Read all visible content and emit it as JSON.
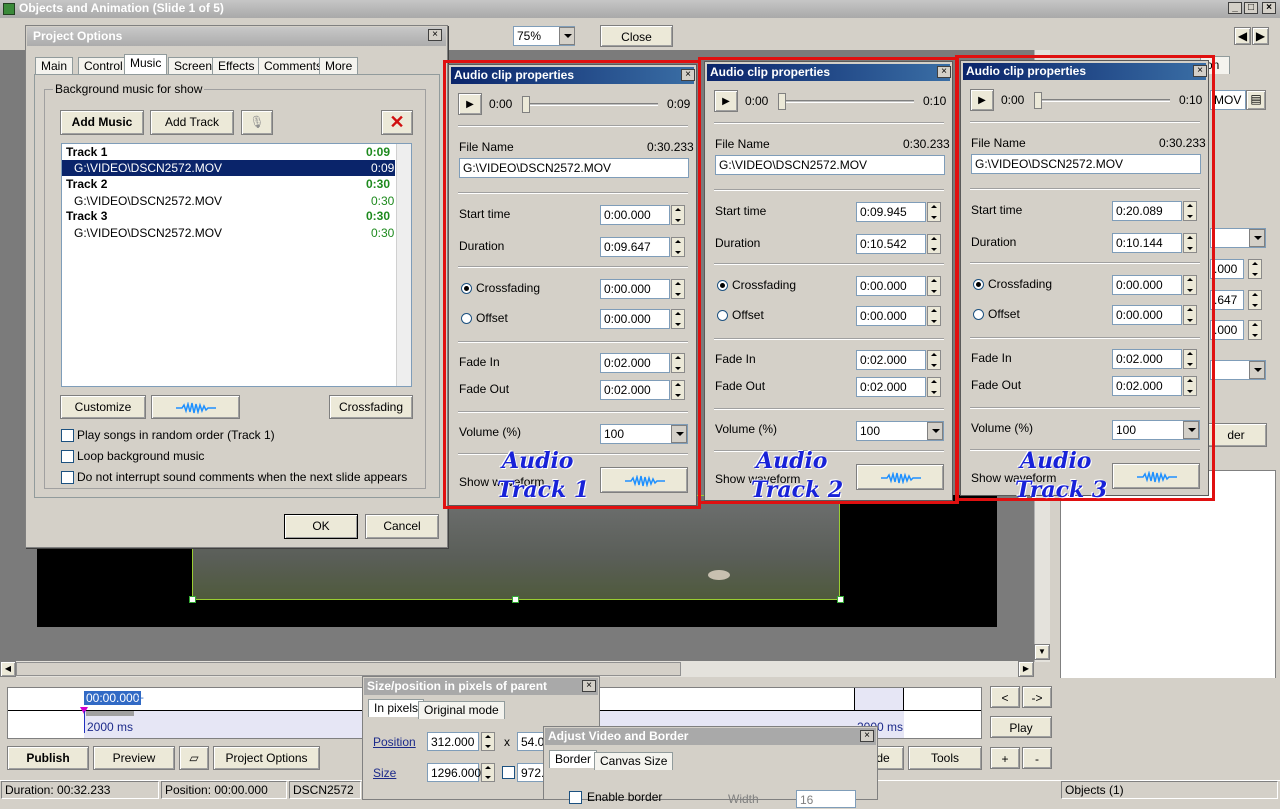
{
  "window": {
    "title": "Objects and Animation  (Slide 1 of 5)",
    "zoom": "75%",
    "close_label": "Close"
  },
  "project_options": {
    "title": "Project Options",
    "tabs": [
      "Main",
      "Control",
      "Music",
      "Screen",
      "Effects",
      "Comments",
      "More"
    ],
    "active_tab": "Music",
    "group_label": "Background music for show",
    "add_music": "Add Music",
    "add_track": "Add Track",
    "tracks": [
      {
        "name": "Track 1",
        "duration": "0:09",
        "file": "G:\\VIDEO\\DSCN2572.MOV",
        "file_duration": "0:09",
        "selected": true
      },
      {
        "name": "Track 2",
        "duration": "0:30",
        "file": "G:\\VIDEO\\DSCN2572.MOV",
        "file_duration": "0:30",
        "selected": false
      },
      {
        "name": "Track 3",
        "duration": "0:30",
        "file": "G:\\VIDEO\\DSCN2572.MOV",
        "file_duration": "0:30",
        "selected": false
      }
    ],
    "customize": "Customize",
    "crossfading": "Crossfading",
    "opt_random": "Play songs in random order (Track 1)",
    "opt_loop": "Loop background music",
    "opt_nointerrupt": "Do not interrupt sound comments when the next slide appears",
    "ok": "OK",
    "cancel": "Cancel"
  },
  "audio_dialogs": [
    {
      "title": "Audio clip properties",
      "pos_start": "0:00",
      "pos_end": "0:09",
      "file_name_label": "File Name",
      "file_length": "0:30.233",
      "file_path": "G:\\VIDEO\\DSCN2572.MOV",
      "start_time_label": "Start time",
      "start_time": "0:00.000",
      "duration_label": "Duration",
      "duration": "0:09.647",
      "crossfading_label": "Crossfading",
      "crossfading": "0:00.000",
      "offset_label": "Offset",
      "offset": "0:00.000",
      "fade_in_label": "Fade In",
      "fade_in": "0:02.000",
      "fade_out_label": "Fade Out",
      "fade_out": "0:02.000",
      "volume_label": "Volume (%)",
      "volume": "100",
      "waveform_label": "Show waveform",
      "annotation_line1": "Audio",
      "annotation_line2": "Track 1"
    },
    {
      "title": "Audio clip properties",
      "pos_start": "0:00",
      "pos_end": "0:10",
      "file_name_label": "File Name",
      "file_length": "0:30.233",
      "file_path": "G:\\VIDEO\\DSCN2572.MOV",
      "start_time_label": "Start time",
      "start_time": "0:09.945",
      "duration_label": "Duration",
      "duration": "0:10.542",
      "crossfading_label": "Crossfading",
      "crossfading": "0:00.000",
      "offset_label": "Offset",
      "offset": "0:00.000",
      "fade_in_label": "Fade In",
      "fade_in": "0:02.000",
      "fade_out_label": "Fade Out",
      "fade_out": "0:02.000",
      "volume_label": "Volume (%)",
      "volume": "100",
      "waveform_label": "Show waveform",
      "annotation_line1": "Audio",
      "annotation_line2": "Track 2"
    },
    {
      "title": "Audio clip properties",
      "pos_start": "0:00",
      "pos_end": "0:10",
      "file_name_label": "File Name",
      "file_length": "0:30.233",
      "file_path": "G:\\VIDEO\\DSCN2572.MOV",
      "start_time_label": "Start time",
      "start_time": "0:20.089",
      "duration_label": "Duration",
      "duration": "0:10.144",
      "crossfading_label": "Crossfading",
      "crossfading": "0:00.000",
      "offset_label": "Offset",
      "offset": "0:00.000",
      "fade_in_label": "Fade In",
      "fade_in": "0:02.000",
      "fade_out_label": "Fade Out",
      "fade_out": "0:02.000",
      "volume_label": "Volume (%)",
      "volume": "100",
      "waveform_label": "Show waveform",
      "annotation_line1": "Audio",
      "annotation_line2": "Track 3"
    }
  ],
  "right_panel": {
    "tab_fragment": "on",
    "file_fragment": "MOV",
    "val1": ".000",
    "val2": ".647",
    "val3": ".000",
    "btn_fragment": "der"
  },
  "timeline": {
    "time": "00:00.000",
    "plus": "+",
    "ms_left": "2000 ms",
    "ms_right": "2000 ms"
  },
  "size_position": {
    "title": "Size/position in pixels of parent",
    "tabs": [
      "In pixels",
      "Original mode"
    ],
    "position_label": "Position",
    "pos_x": "312.000",
    "x_sep": "x",
    "pos_y": "54.00",
    "size_label": "Size",
    "size_w": "1296.000",
    "size_h": "972.0"
  },
  "adjust_video": {
    "title": "Adjust Video and Border",
    "tabs": [
      "Border",
      "Canvas Size"
    ],
    "enable_border": "Enable border",
    "width_label": "Width",
    "width_value": "16"
  },
  "bottom_buttons": {
    "publish": "Publish",
    "preview": "Preview",
    "project_options": "Project Options",
    "mode_fragment": "de",
    "tools": "Tools",
    "prev": "<",
    "next": "->",
    "play": "Play",
    "plus": "+",
    "minus": "-"
  },
  "status": {
    "duration": "Duration:  00:32.233",
    "position": "Position:  00:00.000",
    "file": "DSCN2572",
    "objects": "Objects (1)"
  }
}
